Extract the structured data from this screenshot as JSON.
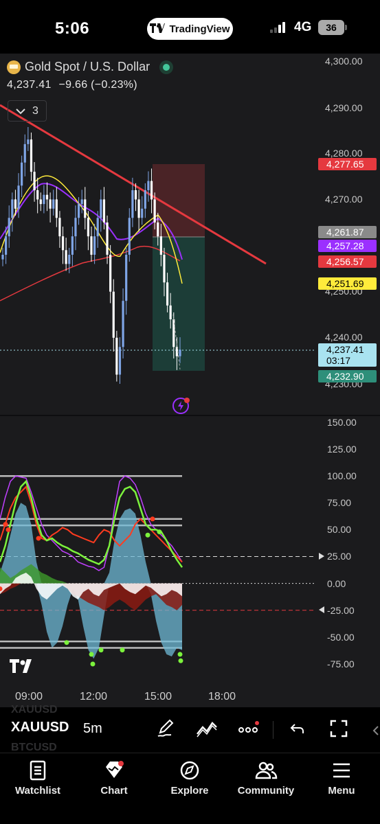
{
  "status_bar": {
    "time": "5:06",
    "app_pill": "TradingView",
    "network": "4G",
    "battery": "36"
  },
  "legend": {
    "symbol_name": "Gold Spot / U.S. Dollar",
    "last_price": "4,237.41",
    "change": "−9.66 (−0.23%)",
    "indicator_count": "3"
  },
  "price_axis": {
    "labels": [
      "4,300.00",
      "4,290.00",
      "4,280.00",
      "4,270.00",
      "4,250.00",
      "4,240.00",
      "4,230.00"
    ],
    "tags": [
      {
        "text": "4,277.65",
        "bg": "#e5393f",
        "fg": "#ffffff"
      },
      {
        "text": "4,261.87",
        "bg": "#8a8a8a",
        "fg": "#ffffff"
      },
      {
        "text": "4,257.28",
        "bg": "#9b30ff",
        "fg": "#ffffff"
      },
      {
        "text": "4,256.57",
        "bg": "#e5393f",
        "fg": "#ffffff"
      },
      {
        "text": "4,251.69",
        "bg": "#ffeb3b",
        "fg": "#000000"
      },
      {
        "text": "4,237.41",
        "bg": "#a9e3f0",
        "fg": "#000000"
      },
      {
        "text": "03:17",
        "bg": "#a9e3f0",
        "fg": "#000000"
      },
      {
        "text": "4,232.90",
        "bg": "#2e8f7a",
        "fg": "#ffffff"
      }
    ]
  },
  "osc_axis": {
    "labels": [
      "150.00",
      "125.00",
      "100.00",
      "75.00",
      "50.00",
      "25.00",
      "0.00",
      "-25.00",
      "-50.00",
      "-75.00"
    ]
  },
  "time_axis": {
    "labels": [
      "09:00",
      "12:00",
      "15:00",
      "18:00"
    ]
  },
  "toolbar": {
    "symbol": "XAUUSD",
    "interval": "5m",
    "ghost_above": "XAUUSD",
    "ghost_below": "BTCUSD"
  },
  "bottom_nav": {
    "items": [
      {
        "label": "Watchlist",
        "icon": "watchlist-icon"
      },
      {
        "label": "Chart",
        "icon": "chart-icon"
      },
      {
        "label": "Explore",
        "icon": "compass-icon"
      },
      {
        "label": "Community",
        "icon": "community-icon"
      },
      {
        "label": "Menu",
        "icon": "menu-icon"
      }
    ]
  },
  "colors": {
    "background": "#1b1b1d",
    "candle_up": "#7fa5e6",
    "candle_down": "#ffffff",
    "trendline": "#e5393f",
    "stop_zone": "#4a2326",
    "target_zone": "#1c3d37",
    "ma_yellow": "#ffeb3b",
    "ma_purple": "#9b30ff",
    "ma_red": "#e5393f",
    "osc_green": "#7cf23c",
    "osc_red": "#ff3b1f",
    "osc_magenta": "#c040ff",
    "osc_area": "#6fb9d6"
  },
  "chart_data": {
    "type": "candlestick",
    "symbol": "XAUUSD",
    "interval": "5m",
    "last": 4237.41,
    "ylim": [
      4229,
      4301
    ],
    "x_ticks": [
      "09:00",
      "12:00",
      "15:00",
      "18:00"
    ],
    "levels": {
      "stop": 4277.65,
      "entry": 4261.87,
      "target": 4232.9
    },
    "moving_averages": [
      {
        "color": "yellow",
        "last": 4251.69
      },
      {
        "color": "purple",
        "last": 4257.28
      },
      {
        "color": "red",
        "last": 4256.57
      }
    ],
    "oscillator": {
      "ylim": [
        -80,
        150
      ],
      "levels": [
        100,
        60,
        54,
        25,
        0,
        -25,
        -54,
        -60
      ]
    }
  }
}
